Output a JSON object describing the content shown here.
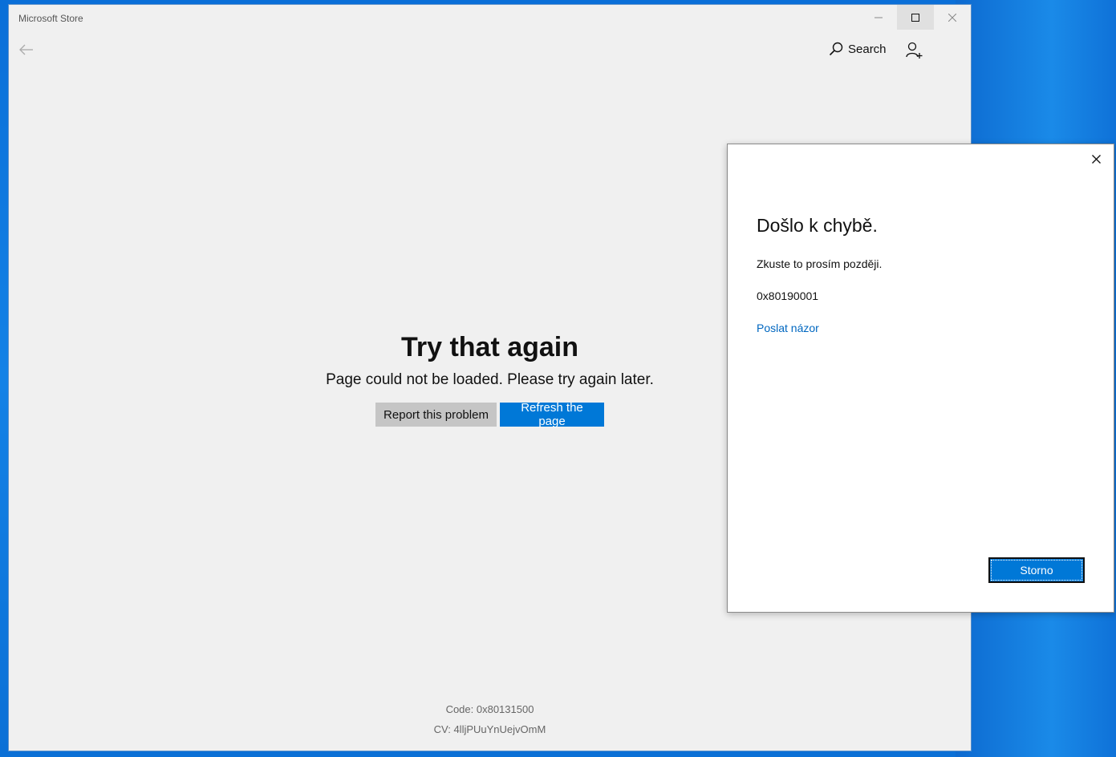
{
  "window": {
    "title": "Microsoft Store",
    "controls": [
      "minimize-icon",
      "maximize-icon",
      "close-icon"
    ]
  },
  "nav": {
    "back_icon": "back-arrow-icon",
    "search_label": "Search",
    "search_icon": "search-icon",
    "account_icon": "add-account-icon"
  },
  "error": {
    "title": "Try that again",
    "message": "Page could not be loaded. Please try again later.",
    "report_label": "Report this problem",
    "refresh_label": "Refresh the page",
    "code": "Code: 0x80131500",
    "cv": "CV: 4lljPUuYnUejvOmM"
  },
  "dialog": {
    "title": "Došlo k chybě.",
    "message": "Zkuste to prosím později.",
    "code": "0x80190001",
    "feedback_link": "Poslat názor",
    "cancel_label": "Storno"
  },
  "colors": {
    "accent": "#0078d7",
    "link": "#0067c0",
    "window_bg": "#f0f0f0",
    "desktop": "#1482e6"
  }
}
